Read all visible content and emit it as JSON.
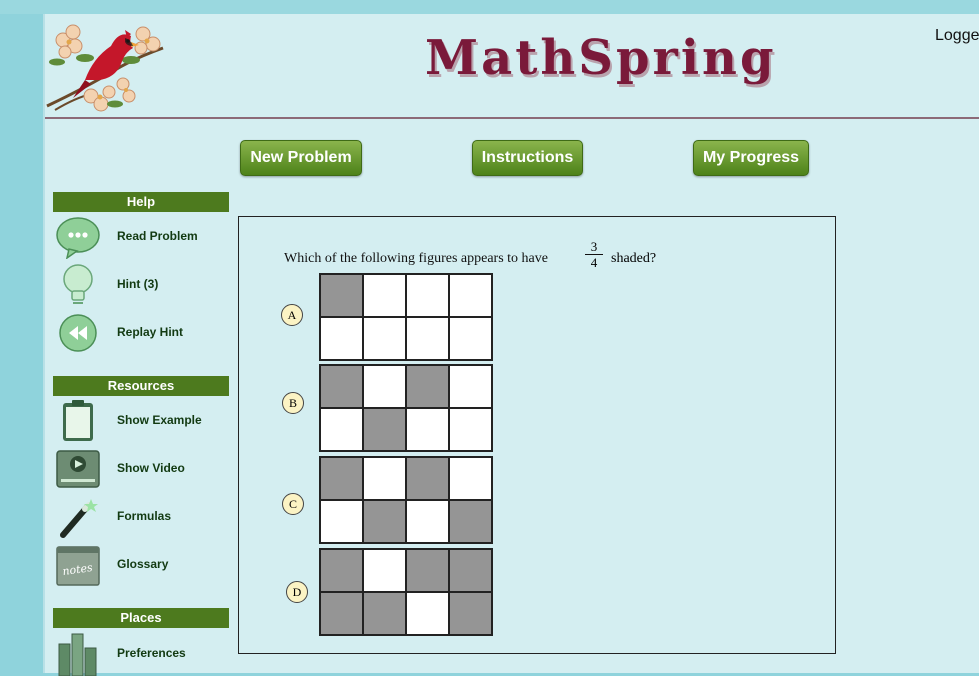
{
  "header": {
    "brand": "MathSpring",
    "logged": "Logge"
  },
  "nav": {
    "new_problem": "New Problem",
    "instructions": "Instructions",
    "my_progress": "My Progress"
  },
  "sidebar": {
    "help": {
      "title": "Help",
      "items": [
        {
          "label": "Read Problem",
          "icon": "speech-bubble-icon"
        },
        {
          "label": "Hint (3)",
          "icon": "lightbulb-icon"
        },
        {
          "label": "Replay Hint",
          "icon": "rewind-icon"
        }
      ]
    },
    "resources": {
      "title": "Resources",
      "items": [
        {
          "label": "Show Example",
          "icon": "clipboard-icon"
        },
        {
          "label": "Show Video",
          "icon": "video-player-icon"
        },
        {
          "label": "Formulas",
          "icon": "magic-wand-icon"
        },
        {
          "label": "Glossary",
          "icon": "notes-icon",
          "icon_text": "notes"
        }
      ]
    },
    "places": {
      "title": "Places",
      "items": [
        {
          "label": "Preferences",
          "icon": "bar-chart-icon"
        }
      ]
    }
  },
  "problem": {
    "question_before": "Which of the following figures appears to have",
    "fraction_num": "3",
    "fraction_den": "4",
    "question_after": "shaded?",
    "choices": [
      {
        "label": "A",
        "shaded": [
          1,
          0,
          0,
          0,
          0,
          0,
          0,
          0
        ]
      },
      {
        "label": "B",
        "shaded": [
          1,
          0,
          1,
          0,
          0,
          1,
          0,
          0
        ]
      },
      {
        "label": "C",
        "shaded": [
          1,
          0,
          1,
          0,
          0,
          1,
          0,
          1
        ]
      },
      {
        "label": "D",
        "shaded": [
          1,
          0,
          1,
          1,
          1,
          1,
          0,
          1
        ]
      }
    ]
  },
  "colors": {
    "brand": "#7a1a3a",
    "button_green": "#5a8f24",
    "section_header": "#4d7a1e",
    "shaded_cell": "#959595",
    "background": "#d4eef1"
  }
}
